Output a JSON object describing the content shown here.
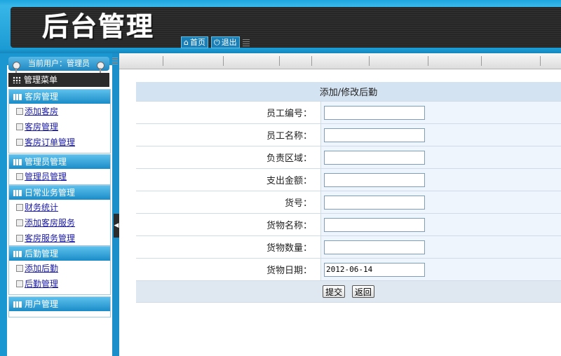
{
  "header": {
    "logo": "后台管理",
    "nav": [
      {
        "label": "首页",
        "icon": "home-icon"
      },
      {
        "label": "退出",
        "icon": "power-icon"
      }
    ]
  },
  "sidebar": {
    "current_user": "当前用户：管理员",
    "menu_title": "管理菜单",
    "groups": [
      {
        "title": "客房管理",
        "items": [
          "添加客房",
          "客房管理",
          "客房订单管理"
        ]
      },
      {
        "title": "管理员管理",
        "items": [
          "管理员管理"
        ]
      },
      {
        "title": "日常业务管理",
        "items": [
          "财务统计",
          "添加客房服务",
          "客房服务管理"
        ]
      },
      {
        "title": "后勤管理",
        "items": [
          "添加后勤",
          "后勤管理"
        ]
      },
      {
        "title": "用户管理",
        "items": []
      }
    ]
  },
  "form": {
    "title": "添加/修改后勤",
    "fields": [
      {
        "label": "员工编号：",
        "value": ""
      },
      {
        "label": "员工名称：",
        "value": ""
      },
      {
        "label": "负责区域：",
        "value": ""
      },
      {
        "label": "支出金额：",
        "value": ""
      },
      {
        "label": "货号：",
        "value": ""
      },
      {
        "label": "货物名称：",
        "value": ""
      },
      {
        "label": "货物数量：",
        "value": ""
      },
      {
        "label": "货物日期：",
        "value": "2012-06-14"
      }
    ],
    "submit_label": "提交",
    "back_label": "返回"
  }
}
